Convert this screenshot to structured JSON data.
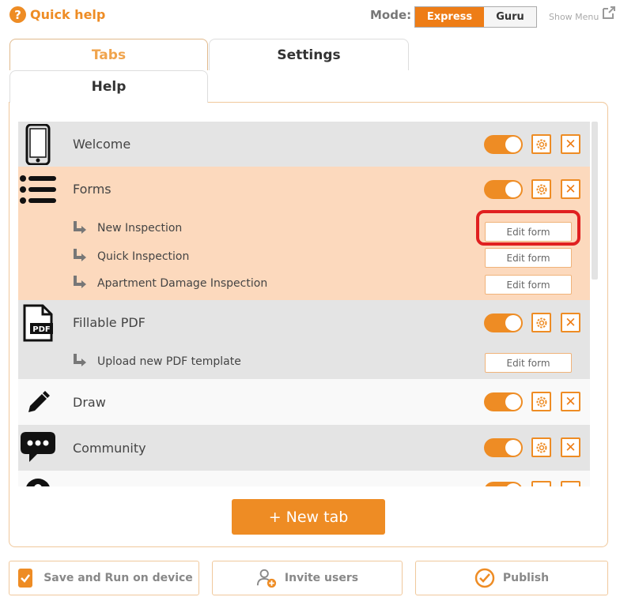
{
  "header": {
    "help_icon_glyph": "?",
    "title": "Quick help",
    "mode_label": "Mode:",
    "mode_express": "Express",
    "mode_guru": "Guru",
    "show_menu": "Show Menu"
  },
  "tabs": {
    "tabs_label": "Tabs",
    "settings_label": "Settings",
    "help_label": "Help"
  },
  "rows": [
    {
      "label": "Welcome",
      "icon": "phone-icon"
    },
    {
      "label": "Forms",
      "icon": "list-icon",
      "subitems": [
        {
          "label": "New Inspection",
          "button": "Edit form"
        },
        {
          "label": "Quick Inspection",
          "button": "Edit form"
        },
        {
          "label": "Apartment Damage Inspection",
          "button": "Edit form"
        }
      ]
    },
    {
      "label": "Fillable PDF",
      "icon": "pdf-icon",
      "icon_text": "PDF",
      "subitems": [
        {
          "label": "Upload new PDF template",
          "button": "Edit form"
        }
      ]
    },
    {
      "label": "Draw",
      "icon": "pencil-icon"
    },
    {
      "label": "Community",
      "icon": "chat-icon"
    }
  ],
  "close_glyph": "✕",
  "new_tab_label": "+ New tab",
  "bottom": {
    "save_label": "Save and Run on device",
    "invite_label": "Invite users",
    "publish_label": "Publish"
  },
  "colors": {
    "accent": "#ee8c24",
    "express_bg": "#ee7d16",
    "row_grey": "#e4e4e4",
    "row_orange": "#fcd9bd",
    "highlight": "#e02020"
  }
}
